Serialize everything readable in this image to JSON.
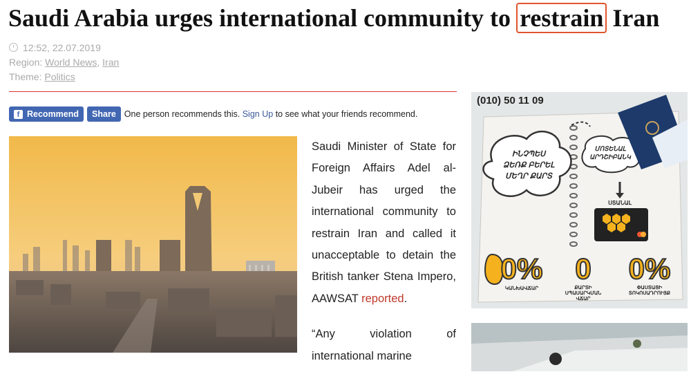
{
  "headline": {
    "before": "Saudi Arabia urges international community to",
    "highlight": "restrain",
    "after": "Iran"
  },
  "meta": {
    "datetime": "12:52, 22.07.2019",
    "region_label": "Region:",
    "region_links": [
      "World News",
      "Iran"
    ],
    "region_sep": ",",
    "theme_label": "Theme:",
    "theme_link": "Politics"
  },
  "facebook": {
    "recommend_label": "Recommend",
    "share_label": "Share",
    "text_before": "One person recommends this.",
    "signup_label": "Sign Up",
    "text_after": "to see what your friends recommend."
  },
  "article": {
    "paragraph1": "Saudi Minister of State for Foreign Affairs Adel al-Jubeir has urged the international community to restrain Iran and called it unacceptable to detain the British tanker Stena Impero, AAWSAT",
    "paragraph1_link": "reported",
    "paragraph1_end": ".",
    "paragraph2": "“Any violation of international marine"
  },
  "ad": {
    "phone": "(010) 50 11 09",
    "cloud_text": [
      "ԻՆՉՊԵՍ",
      "ՁԵՌՔ ԲԵՐԵԼ",
      "ՄԵՂՐ ՔԱՐՏ"
    ],
    "step1": [
      "ՄՈՏԵՆԱԼ",
      "ԱՐԴՇԻԲԱՆԿ"
    ],
    "step2": "ՍՏԱՆԱԼ",
    "stats": [
      {
        "value": "0%",
        "caption": [
          "ԿԱՆԽԱՎՃԱՐ"
        ]
      },
      {
        "value": "0",
        "caption": [
          "ՔԱՐՏԻ",
          "ՍՊԱՍԱՐԿՄԱՆ",
          "ՎՃԱՐ"
        ]
      },
      {
        "value": "0%",
        "caption": [
          "ՓԱՍՏԱՑԻ",
          "ՏՈԿՈՍԱԴՐՈՒՅՔ"
        ]
      }
    ],
    "colors": {
      "accent": "#f5b21e",
      "outline": "#333333"
    }
  },
  "colors": {
    "rule": "#dd3333",
    "facebook": "#4267b2",
    "link": "#c0392b",
    "highlight_box": "#e0552c"
  }
}
